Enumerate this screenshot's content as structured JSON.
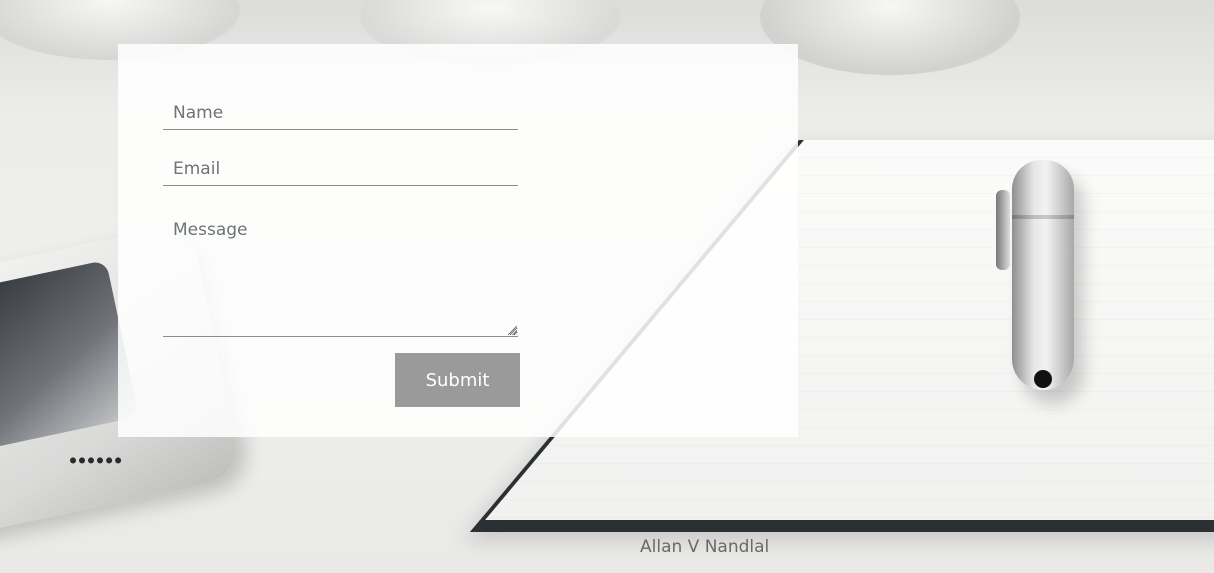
{
  "form": {
    "name_placeholder": "Name",
    "email_placeholder": "Email",
    "message_placeholder": "Message",
    "submit_label": "Submit"
  },
  "footer": {
    "author": "Allan V Nandlal"
  },
  "colors": {
    "panel_background": "#ffffff",
    "submit_background": "#9a9a9a",
    "submit_text": "#ffffff",
    "field_underline": "#8c8c8c",
    "placeholder_text": "#6d7378",
    "footer_text": "#6a6a6a"
  }
}
